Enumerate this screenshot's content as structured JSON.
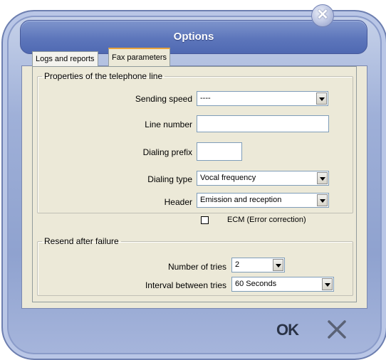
{
  "window": {
    "title": "Options",
    "close_glyph": "✕"
  },
  "tabs": [
    {
      "label": "Logs and reports"
    },
    {
      "label": "Fax parameters"
    }
  ],
  "line_group": {
    "legend": "Properties of the telephone line",
    "sending_speed": {
      "label": "Sending speed",
      "value": "----"
    },
    "line_number": {
      "label": "Line number",
      "value": ""
    },
    "dialing_prefix": {
      "label": "Dialing prefix",
      "value": ""
    },
    "dialing_type": {
      "label": "Dialing type",
      "value": "Vocal frequency"
    },
    "header": {
      "label": "Header",
      "value": "Emission and reception"
    },
    "ecm": {
      "label": "ECM (Error correction)",
      "checked": false
    }
  },
  "resend_group": {
    "legend": "Resend after failure",
    "tries": {
      "label": "Number of tries",
      "value": "2"
    },
    "interval": {
      "label": "Interval between tries",
      "value": "60 Seconds"
    }
  },
  "buttons": {
    "ok": "OK",
    "cancel_icon": "close-x-icon"
  }
}
